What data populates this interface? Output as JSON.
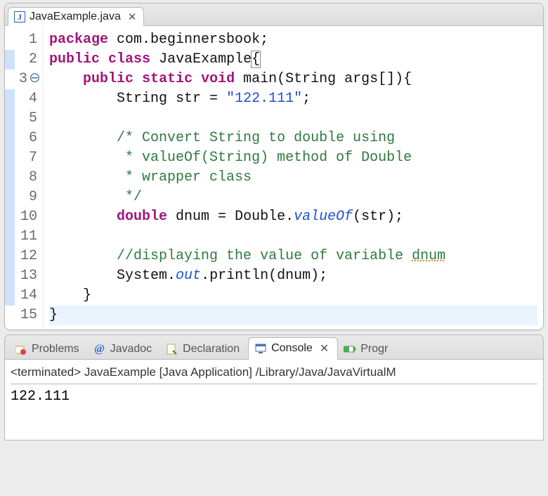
{
  "editor": {
    "tab": {
      "icon_letter": "J",
      "filename": "JavaExample.java"
    },
    "lines": [
      {
        "n": "1",
        "blue": false,
        "fold": "",
        "html": "<span class='kw'>package</span> com.beginnersbook;"
      },
      {
        "n": "2",
        "blue": true,
        "fold": "",
        "html": "<span class='kw'>public</span> <span class='kw'>class</span> JavaExample<span class='boxed'>{</span>"
      },
      {
        "n": "3",
        "blue": false,
        "fold": "⊖",
        "html": "    <span class='kw'>public</span> <span class='kw'>static</span> <span class='kw'>void</span> main(String args[]){"
      },
      {
        "n": "4",
        "blue": true,
        "fold": "",
        "html": "        String str = <span class='str'>\"122.111\"</span>;"
      },
      {
        "n": "5",
        "blue": true,
        "fold": "",
        "html": ""
      },
      {
        "n": "6",
        "blue": true,
        "fold": "",
        "html": "        <span class='comment'>/* Convert String to double using</span>"
      },
      {
        "n": "7",
        "blue": true,
        "fold": "",
        "html": "<span class='comment'>         * valueOf(String) method of Double</span>"
      },
      {
        "n": "8",
        "blue": true,
        "fold": "",
        "html": "<span class='comment'>         * wrapper class</span>"
      },
      {
        "n": "9",
        "blue": true,
        "fold": "",
        "html": "<span class='comment'>         */</span>"
      },
      {
        "n": "10",
        "blue": true,
        "fold": "",
        "html": "        <span class='kw'>double</span> dnum = Double.<span class='it'>valueOf</span>(str);"
      },
      {
        "n": "11",
        "blue": true,
        "fold": "",
        "html": ""
      },
      {
        "n": "12",
        "blue": true,
        "fold": "",
        "html": "        <span class='comment'>//displaying the value of variable </span><span class='comment squiggle'>dnum</span>"
      },
      {
        "n": "13",
        "blue": true,
        "fold": "",
        "html": "        System.<span class='it'>out</span>.println(dnum);"
      },
      {
        "n": "14",
        "blue": true,
        "fold": "",
        "html": "    }"
      },
      {
        "n": "15",
        "blue": false,
        "fold": "",
        "cursor": true,
        "html": "}"
      }
    ]
  },
  "bottom": {
    "tabs": {
      "problems": "Problems",
      "javadoc": "Javadoc",
      "declaration": "Declaration",
      "console": "Console",
      "progress": "Progr"
    },
    "status": "<terminated> JavaExample [Java Application] /Library/Java/JavaVirtualM",
    "output": "122.111"
  }
}
